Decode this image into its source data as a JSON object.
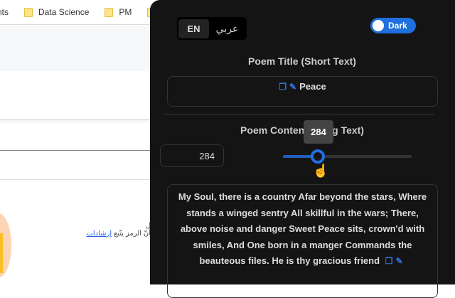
{
  "bookmarks": [
    "nts",
    "Data Science",
    "PM",
    ""
  ],
  "background": {
    "arabic_line1": "ل",
    "arabic_line2_text": "أنّ الرمز يتّبع",
    "arabic_link": "إرشادات"
  },
  "panel": {
    "lang": {
      "en": "EN",
      "ar": "عربي"
    },
    "theme_toggle": {
      "label": "Dark",
      "on": true
    },
    "title_heading": "Poem Title (Short Text)",
    "title_value": "Peace",
    "content_heading": "Poem Content (Long Text)",
    "length_value": "284",
    "slider": {
      "value": 284,
      "fraction": 0.27,
      "tooltip": "284"
    },
    "content_value": "My Soul, there is a country Afar beyond the stars, Where stands a winged sentry All skillful in the wars; There, above noise and danger Sweet Peace sits, crown'd with smiles, And One born in a manger Commands the beauteous files. He is thy gracious friend"
  },
  "colors": {
    "accent": "#1f6fde",
    "panel_bg": "#141414"
  }
}
